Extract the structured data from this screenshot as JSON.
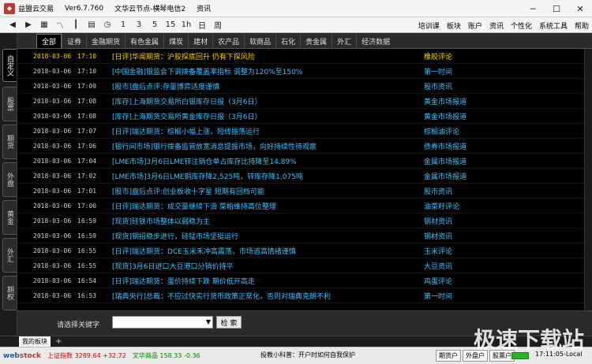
{
  "window": {
    "app_title": "益盟云交易",
    "version": "Ver6.7.760",
    "server": "文华云节点-横琴电信2",
    "section": "资讯"
  },
  "toolbar": {
    "icons": [
      "back-arrow-icon",
      "forward-arrow-icon",
      "grid-icon",
      "line-chart-icon",
      "candlestick-chart-icon",
      "table-icon",
      "clock-icon"
    ],
    "periods": [
      "1",
      "3",
      "5",
      "15",
      "1h",
      "日",
      "周"
    ],
    "menu": [
      "培训课",
      "板块",
      "账户",
      "资讯",
      "个性化",
      "系统工具",
      "帮助"
    ]
  },
  "side_tabs": [
    "自定义",
    "股票",
    "期货",
    "外盘",
    "黄金",
    "外汇",
    "期权"
  ],
  "category_tabs": [
    "全部",
    "证券",
    "金融期货",
    "有色金属",
    "煤炭",
    "建材",
    "农产品",
    "软商品",
    "石化",
    "贵金属",
    "外汇",
    "经济数据"
  ],
  "news": [
    {
      "date": "2018-03-06",
      "time": "17:10",
      "headline": "[日评]华闻期货：沪胶探底回升 仍有下探风险",
      "source": "橡胶评论",
      "color": "#ffd200"
    },
    {
      "date": "2018-03-06",
      "time": "17:10",
      "headline": "[中国金融]银监会下调拨备覆盖率指标 调整为120%至150%",
      "source": "第一时间",
      "color": "#3fc0ff"
    },
    {
      "date": "2018-03-06",
      "time": "17:09",
      "headline": "[股市]盘后点评:存量博弈适度谨慎",
      "source": "股市资讯",
      "color": "#3fc0ff"
    },
    {
      "date": "2018-03-06",
      "time": "17:08",
      "headline": "[库存]上海期货交易所白银库存日报（3月6日）",
      "source": "黄金市场报道",
      "color": "#3fc0ff"
    },
    {
      "date": "2018-03-06",
      "time": "17:08",
      "headline": "[库存]上海期货交易所黄金库存日报（3月6日）",
      "source": "黄金市场报道",
      "color": "#3fc0ff"
    },
    {
      "date": "2018-03-06",
      "time": "17:07",
      "headline": "[日评]瑞达期货：棕榈小幅上涨，短线振荡运行",
      "source": "棕榈油评论",
      "color": "#3fc0ff"
    },
    {
      "date": "2018-03-06",
      "time": "17:06",
      "headline": "[银行间市场]银行拨备监管放宽消息提振市场，向好持续性待观察",
      "source": "债券市场报道",
      "color": "#3fc0ff"
    },
    {
      "date": "2018-03-06",
      "time": "17:04",
      "headline": "[LME市场]3月6日LME锌注销仓单占库存比持降至14.89%",
      "source": "金属市场报道",
      "color": "#3fc0ff"
    },
    {
      "date": "2018-03-06",
      "time": "17:02",
      "headline": "[LME市场]3月6日LME铜库存降2,525吨，锌库存降1,075吨",
      "source": "金属市场报道",
      "color": "#3fc0ff"
    },
    {
      "date": "2018-03-06",
      "time": "17:01",
      "headline": "[股市]盘后点评:创业板收十字星 短期有回档可能",
      "source": "股市资讯",
      "color": "#3fc0ff"
    },
    {
      "date": "2018-03-06",
      "time": "17:00",
      "headline": "[日评]瑞达期货：成交量继续下滑 菜粕维持高位整理",
      "source": "油菜籽评论",
      "color": "#3fc0ff"
    },
    {
      "date": "2018-03-06",
      "time": "16:59",
      "headline": "[现货]硅铁市场整体以弱稳为主",
      "source": "钢材资讯",
      "color": "#3fc0ff"
    },
    {
      "date": "2018-03-06",
      "time": "16:59",
      "headline": "[现货]钢招稳步进行，硅锰市场坚挺运行",
      "source": "钢材资讯",
      "color": "#3fc0ff"
    },
    {
      "date": "2018-03-06",
      "time": "16:55",
      "headline": "[日评]瑞达期货：DCE玉米禾冲高震荡，市场追高情绪谨慎",
      "source": "玉米评论",
      "color": "#3fc0ff"
    },
    {
      "date": "2018-03-06",
      "time": "16:55",
      "headline": "[现货]3月6日进口大豆港口分销价持平",
      "source": "大豆资讯",
      "color": "#3fc0ff"
    },
    {
      "date": "2018-03-06",
      "time": "16:54",
      "headline": "[日评]瑞达期货：蛋价持续下跌 期价低开高走",
      "source": "鸡蛋评论",
      "color": "#3fc0ff"
    },
    {
      "date": "2018-03-06",
      "time": "16:53",
      "headline": "[瑞典央行]总裁：不应过快实行货币政策正常化，否则对瑞典克朗不利",
      "source": "第一时间",
      "color": "#3fc0ff"
    }
  ],
  "keyword_bar": {
    "label": "请选择关键字",
    "select_value": "",
    "search_button": "检 索"
  },
  "sheet_tabs": {
    "active": "我的板块",
    "add": "+"
  },
  "status": {
    "logo_part1": "web",
    "logo_part2": "stock",
    "idx1_name": "上证指数",
    "idx1_value": "3289.64",
    "idx1_change": "+32.72",
    "idx2_name": "文华商品",
    "idx2_value": "158.33",
    "idx2_change": "-0.36",
    "marquee": "投教小科普：开户时如何自我保护",
    "btn1": "期货户",
    "btn2": "外盘户",
    "btn3": "股票户",
    "clock": "17:11:05-Local"
  },
  "watermark": "极速下载站"
}
